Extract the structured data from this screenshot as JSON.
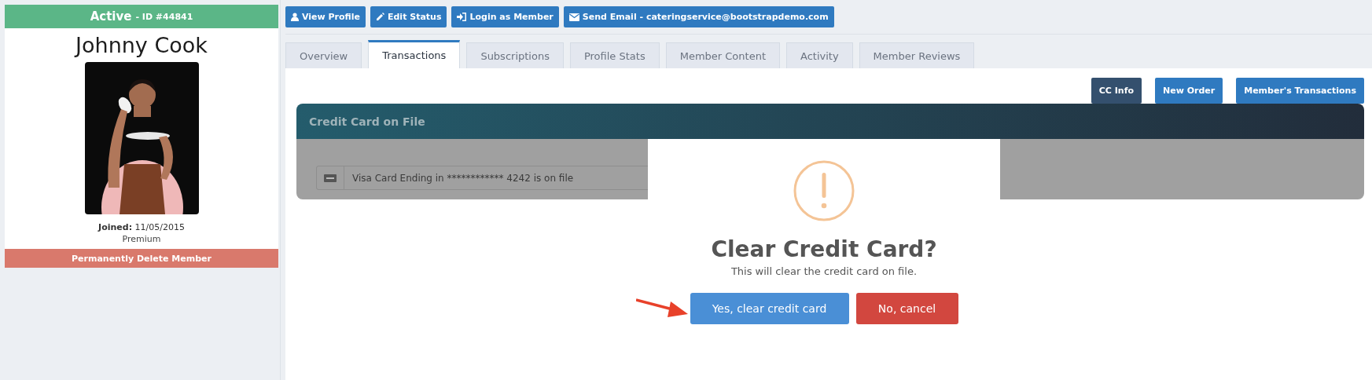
{
  "member": {
    "status": "Active",
    "id": "- ID #44841",
    "name": "Johnny Cook",
    "joined": "**Joined:** 11/05/2015",
    "plan": "Premium",
    "delete_button": "Permanently Delete Member"
  },
  "actions": [
    {
      "label": "View Profile",
      "kind": "profile"
    },
    {
      "label": "Edit Status",
      "kind": "edit"
    },
    {
      "label": "Login as Member",
      "kind": "login"
    },
    {
      "label": "Send Email - cateringservice@bootstrapdemo.com",
      "kind": "email"
    }
  ],
  "tabs": [
    {
      "label": "Overview",
      "selected": false
    },
    {
      "label": "Transactions",
      "selected": true
    },
    {
      "label": "Subscriptions",
      "selected": false
    },
    {
      "label": "Profile Stats",
      "selected": false
    },
    {
      "label": "Member Content",
      "selected": false
    },
    {
      "label": "Activity",
      "selected": false
    },
    {
      "label": "Member Reviews",
      "selected": false
    }
  ],
  "panel_buttons": [
    {
      "label": "CC Info",
      "selected": true
    },
    {
      "label": "New Order",
      "selected": false
    },
    {
      "label": "Member's Transactions",
      "selected": false
    }
  ],
  "card_panel": {
    "title": "Credit Card on File",
    "card_text": "Visa Card Ending in ************ 4242 is on file"
  },
  "dialog": {
    "title": "Clear Credit Card?",
    "message": "This will clear the credit card on file.",
    "buttons": [
      {
        "label": "Yes, clear credit card",
        "kind": "confirm"
      },
      {
        "label": "No, cancel",
        "kind": "cancel"
      }
    ]
  }
}
